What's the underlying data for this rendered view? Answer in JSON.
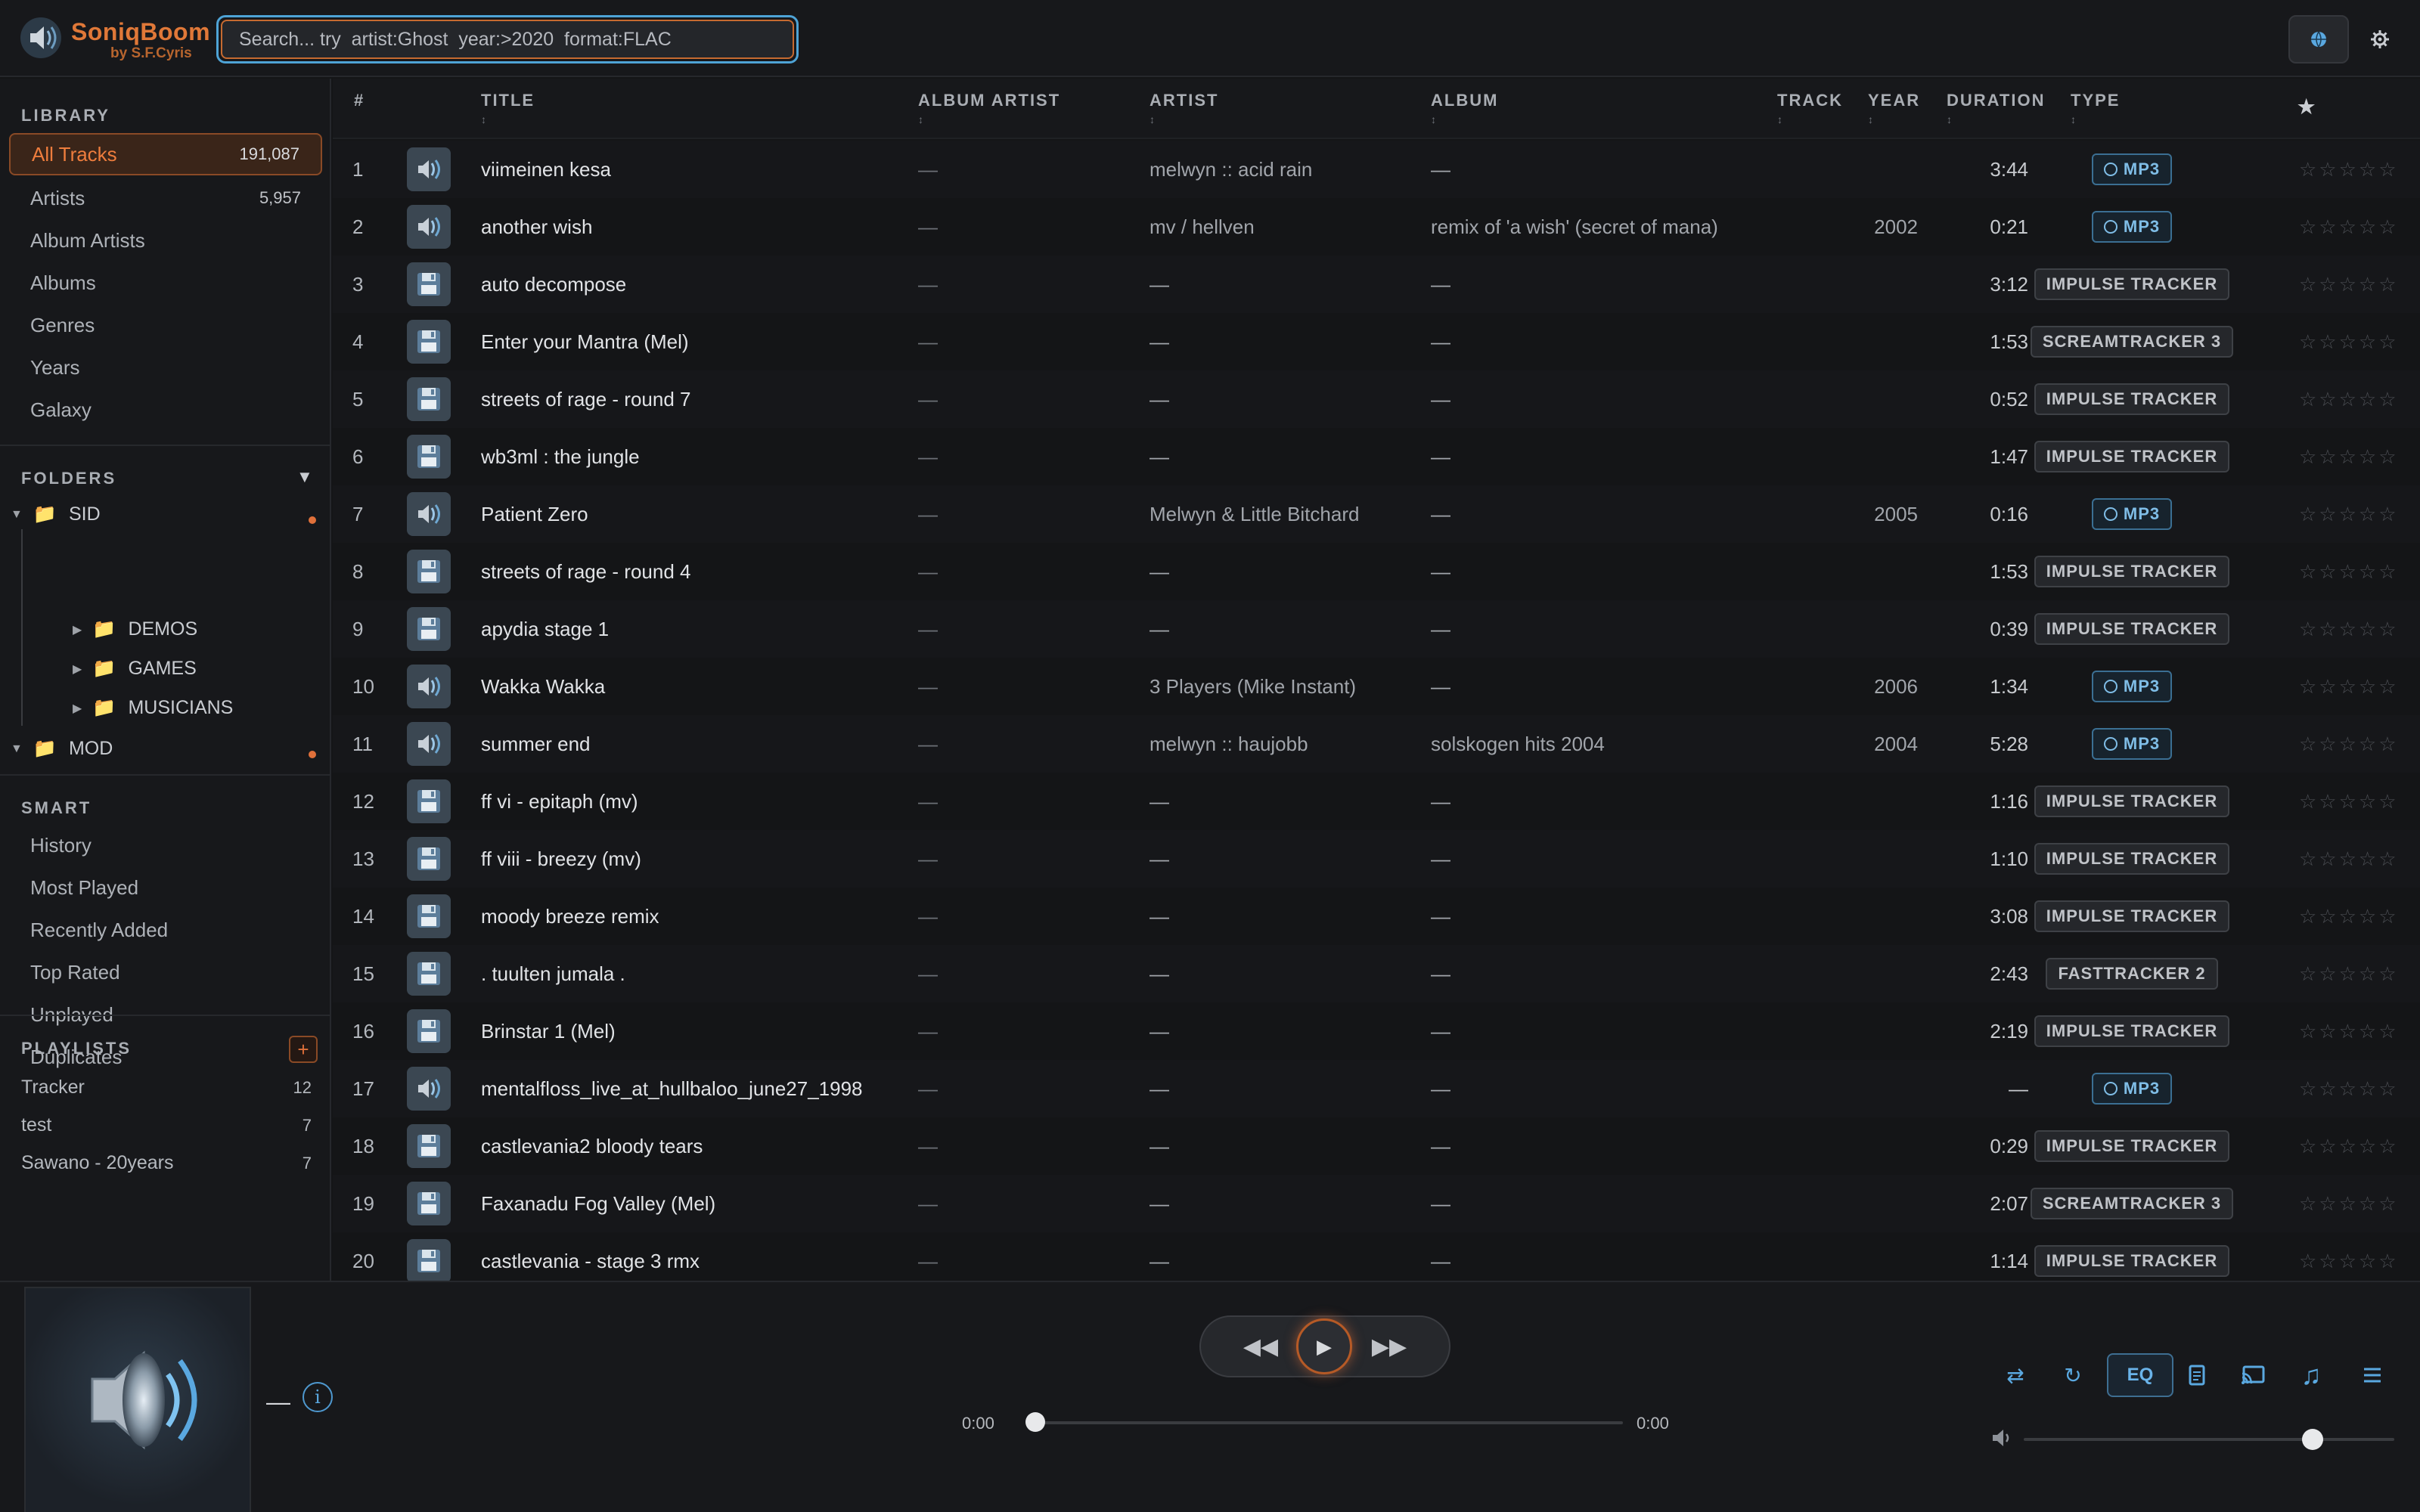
{
  "app": {
    "name": "SoniqBoom",
    "byline": "by S.F.Cyris"
  },
  "search": {
    "placeholder": "Search... try  artist:Ghost  year:>2020  format:FLAC",
    "value": ""
  },
  "header_icons": [
    "globe-icon",
    "gear-icon"
  ],
  "sidebar": {
    "library_label": "LIBRARY",
    "library": [
      {
        "label": "All Tracks",
        "count": "191,087",
        "active": true
      },
      {
        "label": "Artists",
        "count": "5,957"
      },
      {
        "label": "Album Artists",
        "count": ""
      },
      {
        "label": "Albums",
        "count": ""
      },
      {
        "label": "Genres",
        "count": ""
      },
      {
        "label": "Years",
        "count": ""
      },
      {
        "label": "Galaxy",
        "count": ""
      }
    ],
    "folders_label": "FOLDERS",
    "folders": [
      {
        "label": "SID",
        "children": [
          "DEMOS",
          "GAMES",
          "MUSICIANS"
        ]
      },
      {
        "label": "MOD",
        "children": []
      }
    ],
    "smart_label": "SMART",
    "smart": [
      "History",
      "Most Played",
      "Recently Added",
      "Top Rated",
      "Unplayed",
      "Duplicates"
    ],
    "playlists_label": "PLAYLISTS",
    "playlist_add": "+",
    "playlists": [
      {
        "label": "Tracker",
        "count": "12"
      },
      {
        "label": "test",
        "count": "7"
      },
      {
        "label": "Sawano - 20years",
        "count": "7"
      }
    ]
  },
  "table": {
    "columns": [
      "#",
      "TITLE",
      "ALBUM ARTIST",
      "ARTIST",
      "ALBUM",
      "TRACK",
      "YEAR",
      "DURATION",
      "TYPE",
      "★"
    ],
    "sort_mark": "↕",
    "empty": "—",
    "stars": "☆☆☆☆☆",
    "rows": [
      {
        "n": "1",
        "title": "viimeinen kesa",
        "album_artist": "—",
        "artist": "melwyn :: acid rain",
        "album": "—",
        "year": "",
        "duration": "3:44",
        "type": "MP3",
        "icon": "speaker-icon"
      },
      {
        "n": "2",
        "title": "another wish",
        "album_artist": "—",
        "artist": "mv / hellven",
        "album": "remix of 'a wish' (secret of mana)",
        "year": "2002",
        "duration": "0:21",
        "type": "MP3",
        "icon": "speaker-icon"
      },
      {
        "n": "3",
        "title": "auto decompose",
        "album_artist": "—",
        "artist": "—",
        "album": "—",
        "year": "",
        "duration": "3:12",
        "type": "IMPULSE TRACKER",
        "icon": "floppy-icon"
      },
      {
        "n": "4",
        "title": "Enter your Mantra (Mel)",
        "album_artist": "—",
        "artist": "—",
        "album": "—",
        "year": "",
        "duration": "1:53",
        "type": "SCREAMTRACKER 3",
        "icon": "floppy-icon"
      },
      {
        "n": "5",
        "title": "streets of rage - round 7",
        "album_artist": "—",
        "artist": "—",
        "album": "—",
        "year": "",
        "duration": "0:52",
        "type": "IMPULSE TRACKER",
        "icon": "floppy-icon"
      },
      {
        "n": "6",
        "title": "wb3ml : the jungle",
        "album_artist": "—",
        "artist": "—",
        "album": "—",
        "year": "",
        "duration": "1:47",
        "type": "IMPULSE TRACKER",
        "icon": "floppy-icon"
      },
      {
        "n": "7",
        "title": "Patient Zero",
        "album_artist": "—",
        "artist": "Melwyn & Little Bitchard",
        "album": "—",
        "year": "2005",
        "duration": "0:16",
        "type": "MP3",
        "icon": "speaker-icon"
      },
      {
        "n": "8",
        "title": "streets of rage - round 4",
        "album_artist": "—",
        "artist": "—",
        "album": "—",
        "year": "",
        "duration": "1:53",
        "type": "IMPULSE TRACKER",
        "icon": "floppy-icon"
      },
      {
        "n": "9",
        "title": "apydia stage 1",
        "album_artist": "—",
        "artist": "—",
        "album": "—",
        "year": "",
        "duration": "0:39",
        "type": "IMPULSE TRACKER",
        "icon": "floppy-icon"
      },
      {
        "n": "10",
        "title": "Wakka Wakka",
        "album_artist": "—",
        "artist": "3 Players (Mike Instant)",
        "album": "—",
        "year": "2006",
        "duration": "1:34",
        "type": "MP3",
        "icon": "speaker-icon"
      },
      {
        "n": "11",
        "title": "summer end",
        "album_artist": "—",
        "artist": "melwyn :: haujobb",
        "album": "solskogen hits 2004",
        "year": "2004",
        "duration": "5:28",
        "type": "MP3",
        "icon": "speaker-icon"
      },
      {
        "n": "12",
        "title": "ff vi - epitaph (mv)",
        "album_artist": "—",
        "artist": "—",
        "album": "—",
        "year": "",
        "duration": "1:16",
        "type": "IMPULSE TRACKER",
        "icon": "floppy-icon"
      },
      {
        "n": "13",
        "title": "ff viii - breezy (mv)",
        "album_artist": "—",
        "artist": "—",
        "album": "—",
        "year": "",
        "duration": "1:10",
        "type": "IMPULSE TRACKER",
        "icon": "floppy-icon"
      },
      {
        "n": "14",
        "title": "moody breeze remix",
        "album_artist": "—",
        "artist": "—",
        "album": "—",
        "year": "",
        "duration": "3:08",
        "type": "IMPULSE TRACKER",
        "icon": "floppy-icon"
      },
      {
        "n": "15",
        "title": ". tuulten jumala .",
        "album_artist": "—",
        "artist": "—",
        "album": "—",
        "year": "",
        "duration": "2:43",
        "type": "FASTTRACKER 2",
        "icon": "floppy-icon"
      },
      {
        "n": "16",
        "title": "Brinstar 1 (Mel)",
        "album_artist": "—",
        "artist": "—",
        "album": "—",
        "year": "",
        "duration": "2:19",
        "type": "IMPULSE TRACKER",
        "icon": "floppy-icon"
      },
      {
        "n": "17",
        "title": "mentalfloss_live_at_hullbaloo_june27_1998",
        "album_artist": "—",
        "artist": "—",
        "album": "—",
        "year": "",
        "duration": "—",
        "type": "MP3",
        "icon": "speaker-icon"
      },
      {
        "n": "18",
        "title": "castlevania2 bloody tears",
        "album_artist": "—",
        "artist": "—",
        "album": "—",
        "year": "",
        "duration": "0:29",
        "type": "IMPULSE TRACKER",
        "icon": "floppy-icon"
      },
      {
        "n": "19",
        "title": "Faxanadu Fog Valley (Mel)",
        "album_artist": "—",
        "artist": "—",
        "album": "—",
        "year": "",
        "duration": "2:07",
        "type": "SCREAMTRACKER 3",
        "icon": "floppy-icon"
      },
      {
        "n": "20",
        "title": "castlevania - stage 3 rmx",
        "album_artist": "—",
        "artist": "—",
        "album": "—",
        "year": "",
        "duration": "1:14",
        "type": "IMPULSE TRACKER",
        "icon": "floppy-icon"
      }
    ]
  },
  "player": {
    "now_playing_title": "—",
    "info_label": "i",
    "elapsed": "0:00",
    "total": "0:00",
    "progress": 0.0,
    "volume": 0.78,
    "eq_label": "EQ",
    "controls": [
      "shuffle-icon",
      "repeat-icon",
      "eq-button",
      "lyrics-icon",
      "cast-icon",
      "visualizer-icon",
      "queue-icon"
    ]
  },
  "colors": {
    "accent": "#e0703a",
    "link_blue": "#5aa8e0",
    "background": "#141517"
  }
}
